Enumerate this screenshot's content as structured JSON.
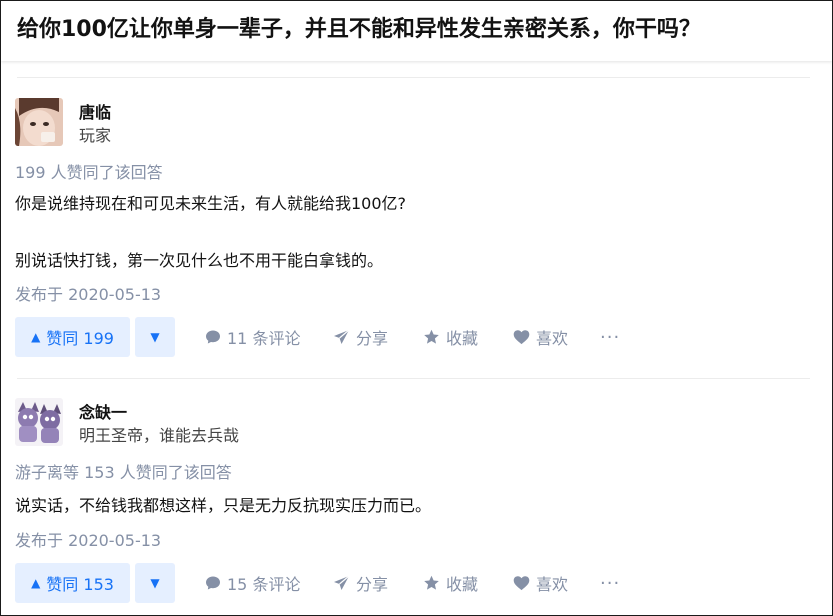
{
  "question": {
    "title": "给你100亿让你单身一辈子，并且不能和异性发生亲密关系，你干吗？"
  },
  "answers": [
    {
      "author": {
        "name": "唐临",
        "bio": "玩家"
      },
      "votes_text": "199 人赞同了该回答",
      "content": [
        "你是说维持现在和可见未来生活，有人就能给我100亿?",
        "别说话快打钱，第一次见什么也不用干能白拿钱的。"
      ],
      "date": "发布于 2020-05-13",
      "actions": {
        "vote_up": "赞同 199",
        "comments": "11 条评论",
        "share": "分享",
        "collect": "收藏",
        "like": "喜欢",
        "more": "···"
      }
    },
    {
      "author": {
        "name": "念缺一",
        "bio": "明王圣帝，谁能去兵哉"
      },
      "votes_text": "游子离等 153 人赞同了该回答",
      "content": [
        "说实话，不给钱我都想这样，只是无力反抗现实压力而已。"
      ],
      "date": "发布于 2020-05-13",
      "actions": {
        "vote_up": "赞同 153",
        "comments": "15 条评论",
        "share": "分享",
        "collect": "收藏",
        "like": "喜欢",
        "more": "···"
      }
    }
  ],
  "icons": {
    "vote_up": "triangle-up-icon",
    "vote_down": "triangle-down-icon",
    "comment": "comment-bubble-icon",
    "share": "paper-plane-icon",
    "collect": "star-icon",
    "like": "heart-icon",
    "more": "ellipsis-icon"
  },
  "colors": {
    "accent": "#1772f6",
    "accent_bg": "#e5efff",
    "meta": "#8590a6"
  }
}
